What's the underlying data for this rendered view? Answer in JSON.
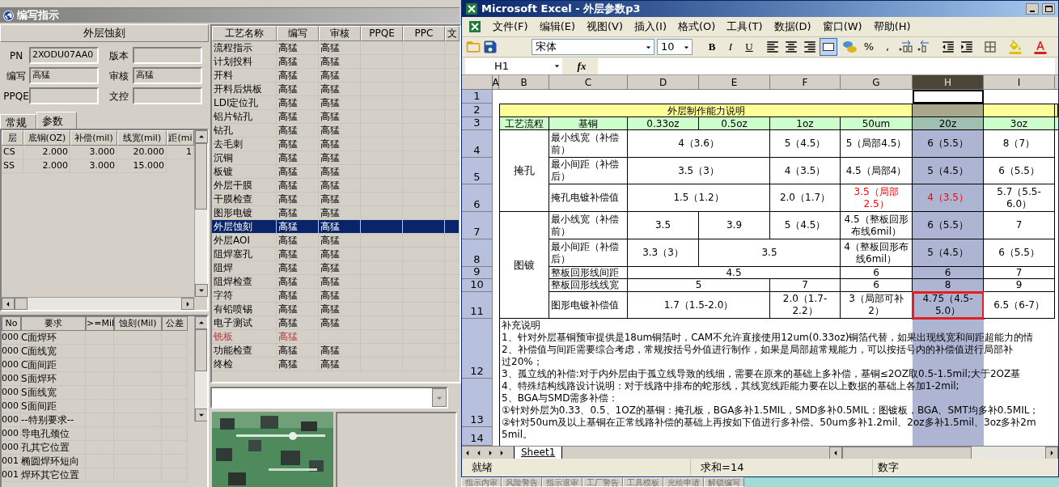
{
  "writer_window": {
    "title": "编写指示",
    "heading": "外层蚀刻",
    "fields": [
      {
        "label": "PN",
        "value": "2XODU07AA0"
      },
      {
        "label": "版本"
      },
      {
        "label": "编写",
        "value": "高猛"
      },
      {
        "label": "审核",
        "value": "高猛"
      },
      {
        "label": "PPQE"
      },
      {
        "label": "文控"
      }
    ],
    "tabs": [
      {
        "label": "常规",
        "selected": false
      },
      {
        "label": "参数",
        "selected": true
      }
    ],
    "layer_table": {
      "columns": [
        "层",
        "底铜(OZ)",
        "补偿(mil)",
        "线宽(mil)",
        "距(mi"
      ],
      "rows": [
        [
          "CS",
          "2.000",
          "3.000",
          "20.000",
          "1"
        ],
        [
          "SS",
          "2.000",
          "3.000",
          "15.000"
        ]
      ]
    },
    "requirement_table": {
      "columns": [
        "No",
        "要求",
        ">=Mil",
        "蚀刻(Mil)",
        "公差"
      ],
      "rows": [
        {
          "no": "000",
          "requirement": "C面焊环"
        },
        {
          "no": "000",
          "requirement": "C面线宽"
        },
        {
          "no": "000",
          "requirement": "C面间距"
        },
        {
          "no": "000",
          "requirement": "S面焊环"
        },
        {
          "no": "000",
          "requirement": "S面线宽"
        },
        {
          "no": "000",
          "requirement": "S面间距"
        },
        {
          "no": "000",
          "requirement": "--特别要求--"
        },
        {
          "no": "000",
          "requirement": "导电孔颈位"
        },
        {
          "no": "000",
          "requirement": "孔其它位置"
        },
        {
          "no": "001",
          "requirement": "椭圆焊环短向"
        },
        {
          "no": "001",
          "requirement": "焊环其它位置"
        }
      ]
    },
    "process_table": {
      "columns": [
        "工艺名称",
        "编写",
        "审核",
        "PPQE",
        "PPC",
        "文"
      ],
      "rows": [
        {
          "name": "流程指示",
          "writer": "高猛",
          "reviewer": "高猛",
          "selected": false,
          "reviewed": true
        },
        {
          "name": "计划投料",
          "writer": "高猛",
          "reviewer": "高猛",
          "selected": false,
          "reviewed": true
        },
        {
          "name": "开料",
          "writer": "高猛",
          "reviewer": "高猛",
          "selected": false,
          "reviewed": true
        },
        {
          "name": "开料后烘板",
          "writer": "高猛",
          "reviewer": "高猛",
          "selected": false,
          "reviewed": true
        },
        {
          "name": "LDI定位孔",
          "writer": "高猛",
          "reviewer": "高猛",
          "selected": false,
          "reviewed": true
        },
        {
          "name": "铝片钻孔",
          "writer": "高猛",
          "reviewer": "高猛",
          "selected": false,
          "reviewed": true
        },
        {
          "name": "钻孔",
          "writer": "高猛",
          "reviewer": "高猛",
          "selected": false,
          "reviewed": true
        },
        {
          "name": "去毛刺",
          "writer": "高猛",
          "reviewer": "高猛",
          "selected": false,
          "reviewed": true
        },
        {
          "name": "沉铜",
          "writer": "高猛",
          "reviewer": "高猛",
          "selected": false,
          "reviewed": true
        },
        {
          "name": "板镀",
          "writer": "高猛",
          "reviewer": "高猛",
          "selected": false,
          "reviewed": true
        },
        {
          "name": "外层干膜",
          "writer": "高猛",
          "reviewer": "高猛",
          "selected": false,
          "reviewed": true
        },
        {
          "name": "干膜检查",
          "writer": "高猛",
          "reviewer": "高猛",
          "selected": false,
          "reviewed": true
        },
        {
          "name": "图形电镀",
          "writer": "高猛",
          "reviewer": "高猛",
          "selected": false,
          "reviewed": true
        },
        {
          "name": "外层蚀刻",
          "writer": "高猛",
          "reviewer": "高猛",
          "selected": true,
          "reviewed": true
        },
        {
          "name": "外层AOI",
          "writer": "高猛",
          "reviewer": "高猛",
          "selected": false,
          "reviewed": true
        },
        {
          "name": "阻焊塞孔",
          "writer": "高猛",
          "reviewer": "高猛",
          "selected": false,
          "reviewed": true
        },
        {
          "name": "阻焊",
          "writer": "高猛",
          "reviewer": "高猛",
          "selected": false,
          "reviewed": true
        },
        {
          "name": "阻焊检查",
          "writer": "高猛",
          "reviewer": "高猛",
          "selected": false,
          "reviewed": true
        },
        {
          "name": "字符",
          "writer": "高猛",
          "reviewer": "高猛",
          "selected": false,
          "reviewed": true
        },
        {
          "name": "有铅喷锡",
          "writer": "高猛",
          "reviewer": "高猛",
          "selected": false,
          "reviewed": true
        },
        {
          "name": "电子测试",
          "writer": "高猛",
          "reviewer": "高猛",
          "selected": false,
          "reviewed": true
        },
        {
          "name": "铣板",
          "writer": "高猛",
          "selected": false,
          "reviewed": false
        },
        {
          "name": "功能检查",
          "writer": "高猛",
          "reviewer": "高猛",
          "selected": false,
          "reviewed": true
        },
        {
          "name": "终检",
          "writer": "高猛",
          "reviewer": "高猛",
          "selected": false,
          "reviewed": true
        }
      ]
    }
  },
  "excel": {
    "title": "Microsoft Excel - 外层参数p3",
    "menus": [
      "文件(F)",
      "编辑(E)",
      "视图(V)",
      "插入(I)",
      "格式(O)",
      "工具(T)",
      "数据(D)",
      "窗口(W)",
      "帮助(H)"
    ],
    "font": "宋体",
    "font_size": "10",
    "style_buttons": [
      "B",
      "I",
      "U"
    ],
    "number_buttons": [
      "%",
      ","
    ],
    "name_box": "H1",
    "fx": "fx",
    "columns": [
      {
        "label": "A",
        "selected": false
      },
      {
        "label": "B",
        "selected": false
      },
      {
        "label": "C",
        "selected": false
      },
      {
        "label": "D",
        "selected": false
      },
      {
        "label": "E",
        "selected": false
      },
      {
        "label": "F",
        "selected": false
      },
      {
        "label": "G",
        "selected": false
      },
      {
        "label": "H",
        "selected": true
      },
      {
        "label": "I",
        "selected": false
      }
    ],
    "row_numbers": [
      "1",
      "2",
      "3",
      "4",
      "5",
      "6",
      "7",
      "8",
      "9",
      "10",
      "11",
      "12",
      "13",
      "14"
    ],
    "sheet": {
      "title": "外层制作能力说明",
      "header_row": [
        "工艺流程",
        "基铜",
        "0.33oz",
        "0.5oz",
        "1oz",
        "50um",
        "20z",
        "3oz"
      ],
      "groups": [
        {
          "name": "掩孔",
          "rows": [
            {
              "item": "最小线宽（补偿前）",
              "values": [
                {
                  "text": "4（3.6）",
                  "warning": false,
                  "marked": false
                },
                {
                  "text": "5（4.5）",
                  "warning": false,
                  "marked": false
                },
                {
                  "text": "5（局部4.5）",
                  "warning": false,
                  "marked": false
                },
                {
                  "text": "6（5.5）",
                  "warning": false,
                  "marked": false
                },
                {
                  "text": "8（7）",
                  "warning": false,
                  "marked": false
                }
              ]
            },
            {
              "item": "最小间距（补偿后）",
              "values": [
                {
                  "text": "3.5（3）",
                  "warning": false,
                  "marked": false
                },
                {
                  "text": "4（3.5）",
                  "warning": false,
                  "marked": false
                },
                {
                  "text": "4.5（局部4）",
                  "warning": false,
                  "marked": false
                },
                {
                  "text": "5（4.5）",
                  "warning": false,
                  "marked": false
                },
                {
                  "text": "6（5.5）",
                  "warning": false,
                  "marked": false
                }
              ]
            },
            {
              "item": "掩孔电镀补偿值",
              "values": [
                {
                  "text": "1.5（1.2）",
                  "warning": false,
                  "marked": false
                },
                {
                  "text": "2.0（1.7）",
                  "warning": false,
                  "marked": false
                },
                {
                  "text": "3.5（局部2.5）",
                  "warning": true,
                  "marked": false
                },
                {
                  "text": "4（3.5）",
                  "warning": true,
                  "marked": false
                },
                {
                  "text": "5.7（5.5-6.0）",
                  "warning": false,
                  "marked": false
                }
              ]
            }
          ]
        },
        {
          "name": "图镀",
          "rows": [
            {
              "item": "最小线宽（补偿前）",
              "values": [
                {
                  "text": "3.5",
                  "warning": false,
                  "marked": false
                },
                {
                  "text": "3.9",
                  "warning": false,
                  "marked": false
                },
                {
                  "text": "5（4.5）",
                  "warning": false,
                  "marked": false
                },
                {
                  "text": "4.5（整板回形布线6mil）",
                  "warning": false,
                  "marked": false
                },
                {
                  "text": "6（5.5）",
                  "warning": false,
                  "marked": false
                },
                {
                  "text": "7",
                  "warning": false,
                  "marked": false
                }
              ]
            },
            {
              "item": "最小间距（补偿后）",
              "values": [
                {
                  "text": "3.3（3）",
                  "warning": false,
                  "marked": false
                },
                {
                  "text": "3.5",
                  "warning": false,
                  "marked": false
                },
                {
                  "text": "4（整板回形布线6mil）",
                  "warning": false,
                  "marked": false
                },
                {
                  "text": "5（4.5）",
                  "warning": false,
                  "marked": false
                },
                {
                  "text": "6（5.5）",
                  "warning": false,
                  "marked": false
                }
              ]
            },
            {
              "item": "整板回形线间距",
              "values": [
                {
                  "text": "4.5",
                  "warning": false,
                  "marked": false
                },
                {
                  "text": "6",
                  "warning": false,
                  "marked": false
                },
                {
                  "text": "6",
                  "warning": false,
                  "marked": false
                },
                {
                  "text": "7",
                  "warning": false,
                  "marked": false
                }
              ]
            },
            {
              "item": "整板回形线线宽",
              "values": [
                {
                  "text": "5",
                  "warning": false,
                  "marked": false
                },
                {
                  "text": "7",
                  "warning": false,
                  "marked": false
                },
                {
                  "text": "6",
                  "warning": false,
                  "marked": false
                },
                {
                  "text": "8",
                  "warning": false,
                  "marked": false
                },
                {
                  "text": "9",
                  "warning": false,
                  "marked": false
                }
              ]
            },
            {
              "item": "图形电镀补偿值",
              "values": [
                {
                  "text": "1.7（1.5-2.0）",
                  "warning": false,
                  "marked": false
                },
                {
                  "text": "2.0（1.7-2.2）",
                  "warning": false,
                  "marked": false
                },
                {
                  "text": "3（局部可补2）",
                  "warning": false,
                  "marked": false
                },
                {
                  "text": "4.75（4.5-5.0）",
                  "warning": false,
                  "marked": true
                },
                {
                  "text": "6.5（6-7）",
                  "warning": false,
                  "marked": false
                }
              ]
            }
          ]
        }
      ],
      "notes_title": "补充说明",
      "notes": [
        "1、针对外层基铜预审提供是18um铜箔时，CAM不允许直接使用12um(0.33oz)铜箔代替，如果出现线宽和间距超能力的情",
        "2、补偿值与间距需要综合考虑，常规按括号外值进行制作，如果是局部超常规能力，可以按括号内的补偿值进行局部补",
        "过20%；",
        "3、孤立线的补偿:对于内外层由于孤立线导致的线细，需要在原来的基础上多补偿，基铜≤2OZ取0.5-1.5mil;大于2OZ基",
        "4、特殊结构线路设计说明：对于线路中排布的蛇形线，其线宽线距能力要在以上数据的基础上各加1-2mil;",
        "5、BGA与SMD需多补偿：",
        "①针对外层为0.33、0.5、1OZ的基铜：掩孔板，BGA多补1.5MIL，SMD多补0.5MIL；图镀板，BGA、SMT均多补0.5MIL；",
        "②针对50um及以上基铜在正常线路补偿的基础上再按如下值进行多补偿。50um多补1.2mil、2oz多补1.5mil、3oz多补2m",
        "5mil。"
      ]
    },
    "sheet_tabs": [
      {
        "label": "Sheet1",
        "selected": true
      }
    ],
    "status": "就绪",
    "sum": "求和=14",
    "mode": "数字"
  },
  "taskbar": [
    "指示内审",
    "风险警告",
    "指示退审",
    "工厂警告",
    "工具模板",
    "光绘申请",
    "解锁编写"
  ]
}
